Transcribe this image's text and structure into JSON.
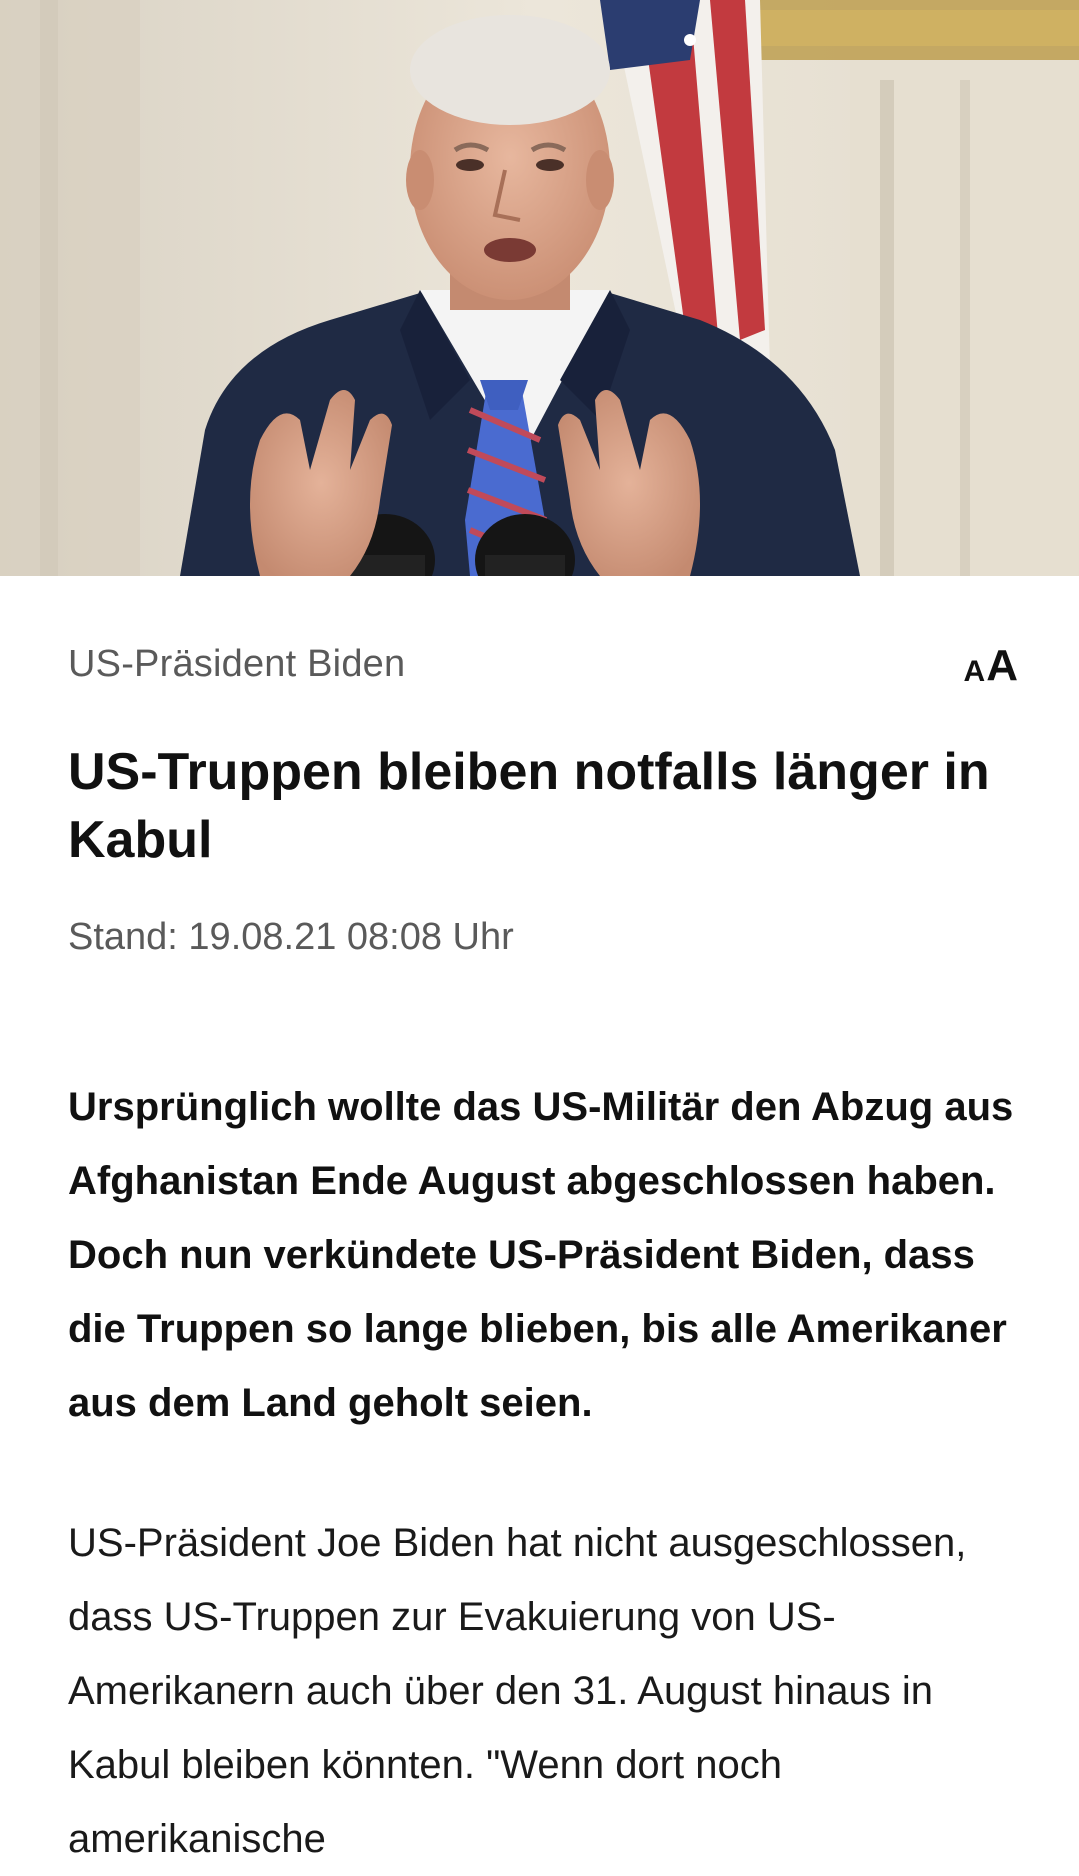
{
  "hero_image": {
    "alt": "US-Präsident Biden"
  },
  "article": {
    "topline": "US-Präsident Biden",
    "font_size_toggle": {
      "small": "A",
      "large": "A"
    },
    "headline": "US-Truppen bleiben notfalls länger in Kabul",
    "dateline": "Stand: 19.08.21 08:08 Uhr",
    "teaser": "Ursprünglich wollte das US-Militär den Abzug aus Afghanistan Ende August abgeschlossen haben. Doch nun verkündete US-Präsident Biden, dass die Truppen so lange blieben, bis alle Amerikaner aus dem Land geholt seien.",
    "body_paragraph_1": "US-Präsident Joe Biden hat nicht ausgeschlossen, dass US-Truppen zur Evakuierung von US-Amerikanern auch über den 31. August hinaus in Kabul bleiben könnten. \"Wenn dort noch amerikanische"
  },
  "colors": {
    "text_primary": "#111111",
    "text_secondary": "#5a5a5a",
    "background": "#ffffff"
  }
}
